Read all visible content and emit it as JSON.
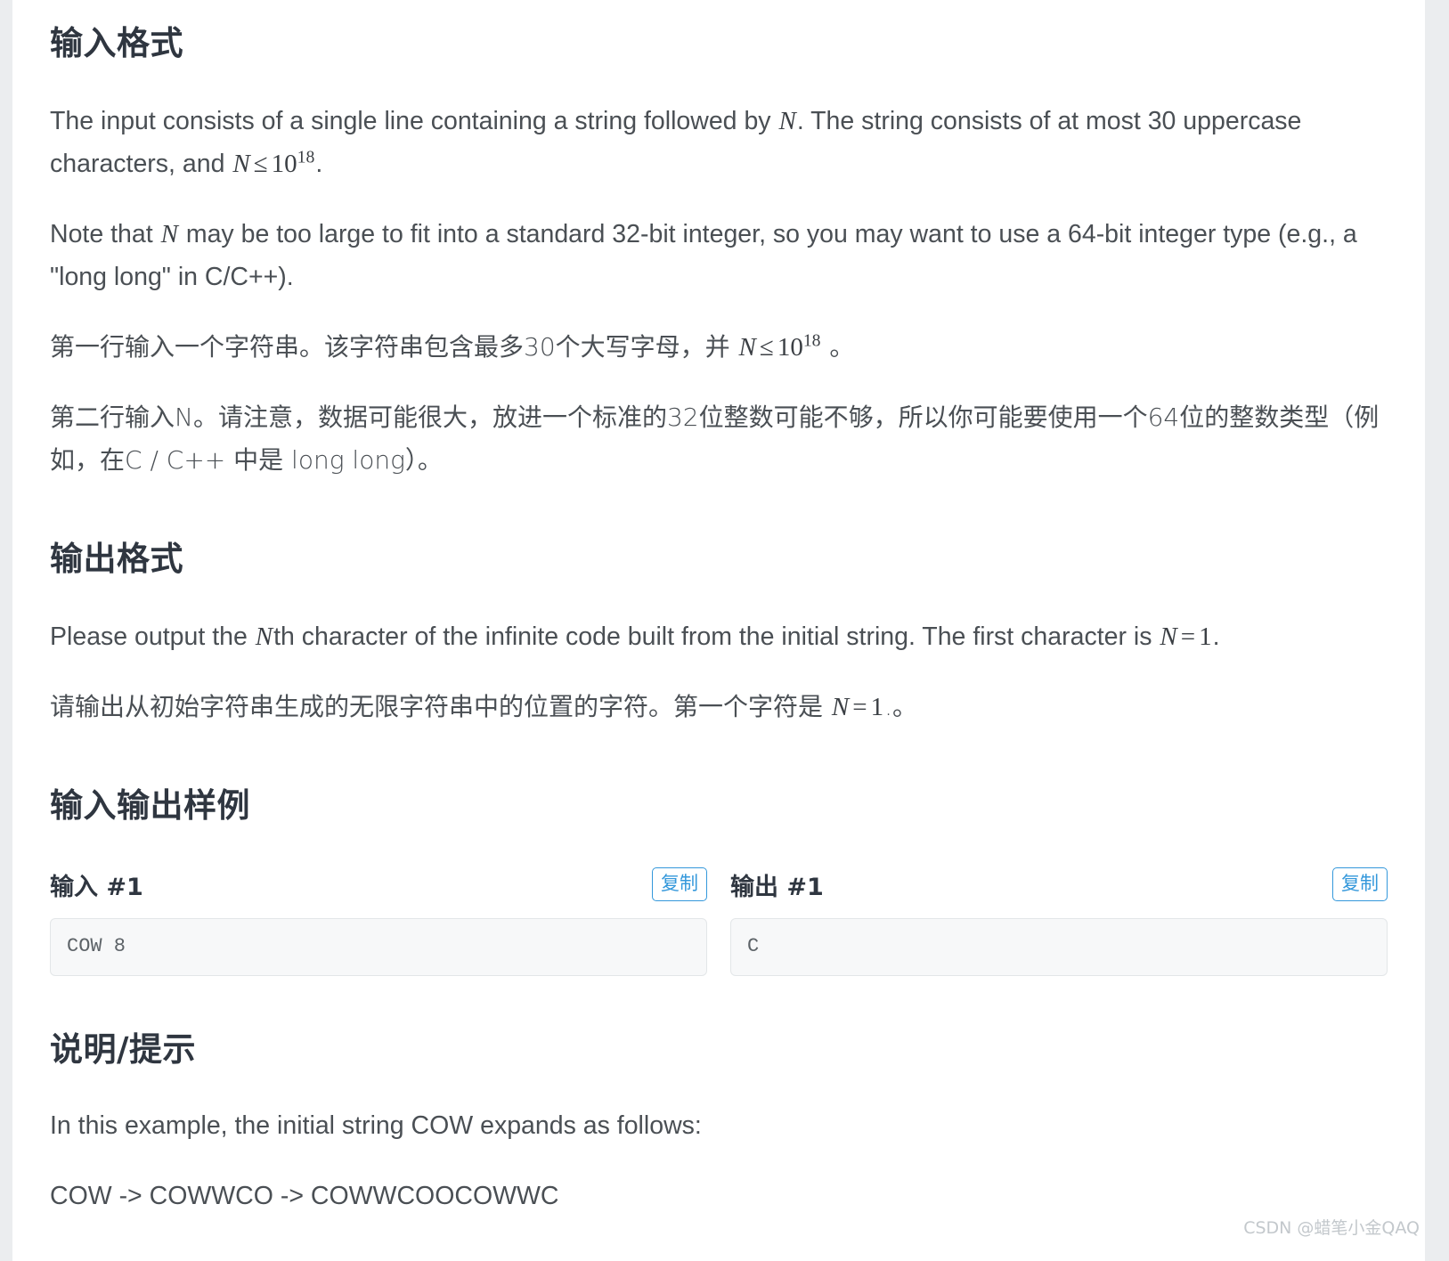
{
  "sections": {
    "input_format": {
      "heading": "输入格式",
      "para_en_1_a": "The input consists of a single line containing a string followed by ",
      "para_en_1_math1": "N",
      "para_en_1_b": ". The string consists of at most 30 uppercase characters, and ",
      "para_en_1_math2_var": "N",
      "para_en_1_math2_op": "≤",
      "para_en_1_math2_base": "10",
      "para_en_1_math2_exp": "18",
      "para_en_1_c": ".",
      "para_en_2_a": "Note that ",
      "para_en_2_math": "N",
      "para_en_2_b": " may be too large to fit into a standard 32-bit integer, so you may want to use a 64-bit integer type (e.g., a \"long long\" in C/C++).",
      "para_cn_1_a": "第一行输入一个字符串。该字符串包含最多30个大写字母，并 ",
      "para_cn_1_math_var": "N",
      "para_cn_1_math_op": "≤",
      "para_cn_1_math_base": "10",
      "para_cn_1_math_exp": "18",
      "para_cn_1_b": " 。",
      "para_cn_2": "第二行输入N。请注意，数据可能很大，放进一个标准的32位整数可能不够，所以你可能要使用一个64位的整数类型（例如，在C / C++ 中是 long long）。"
    },
    "output_format": {
      "heading": "输出格式",
      "para_en_a": "Please output the ",
      "para_en_math1": "N",
      "para_en_b": "th character of the infinite code built from the initial string. The first character is ",
      "para_en_math2_var": "N",
      "para_en_math2_op": "=",
      "para_en_math2_val": "1",
      "para_en_c": ".",
      "para_cn_a": "请输出从初始字符串生成的无限字符串中的位置的字符。第一个字符是 ",
      "para_cn_math_var": "N",
      "para_cn_math_op": "=",
      "para_cn_math_val": "1",
      "para_cn_b": ".。"
    },
    "samples": {
      "heading": "输入输出样例",
      "items": [
        {
          "title": "输入 #1",
          "copy_label": "复制",
          "code": "COW 8"
        },
        {
          "title": "输出 #1",
          "copy_label": "复制",
          "code": "C"
        }
      ]
    },
    "hint": {
      "heading": "说明/提示",
      "para_1": "In this example, the initial string COW expands as follows:",
      "para_2": "COW -> COWWCO -> COWWCOOCOWWC"
    }
  },
  "watermark": "CSDN @蜡笔小金QAQ",
  "colors": {
    "accent": "#3498db",
    "heading": "#2f3640",
    "body_text": "#4a4f54",
    "code_bg": "#f7f8f9",
    "page_bg": "#ebedef"
  }
}
